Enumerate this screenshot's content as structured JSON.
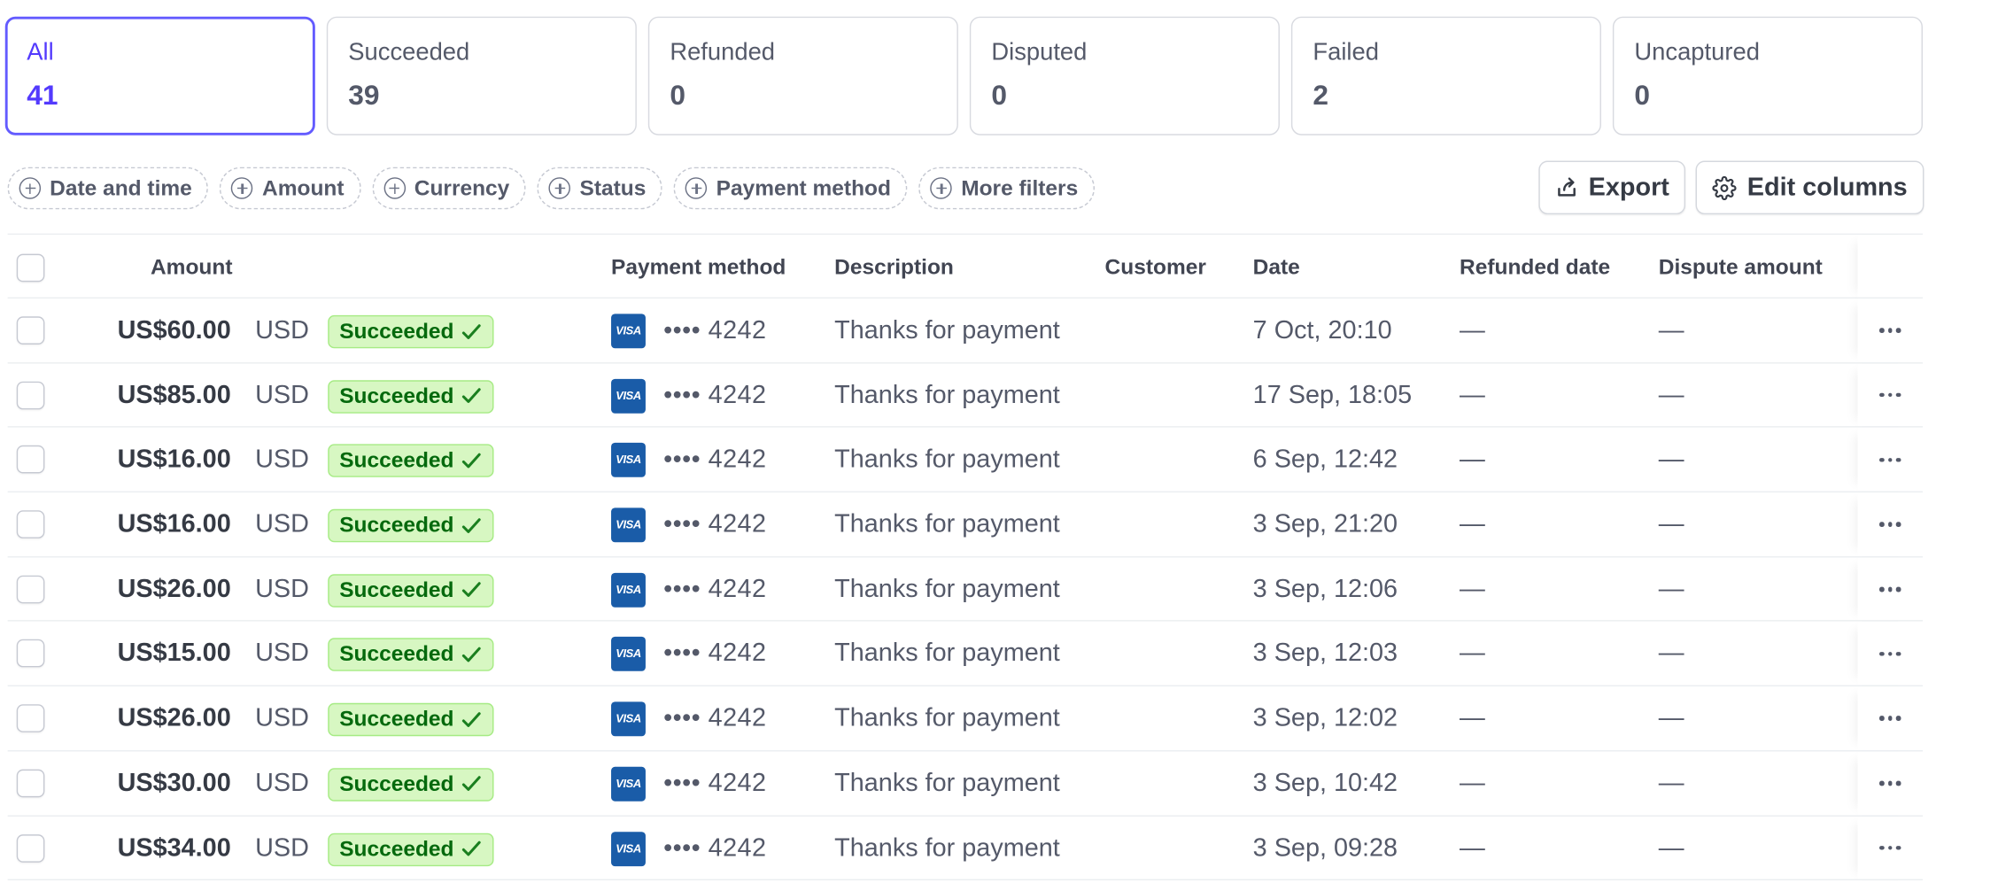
{
  "status_tabs": [
    {
      "label": "All",
      "count": "41",
      "active": true
    },
    {
      "label": "Succeeded",
      "count": "39",
      "active": false
    },
    {
      "label": "Refunded",
      "count": "0",
      "active": false
    },
    {
      "label": "Disputed",
      "count": "0",
      "active": false
    },
    {
      "label": "Failed",
      "count": "2",
      "active": false
    },
    {
      "label": "Uncaptured",
      "count": "0",
      "active": false
    }
  ],
  "filters": [
    "Date and time",
    "Amount",
    "Currency",
    "Status",
    "Payment method",
    "More filters"
  ],
  "actions": {
    "export_label": "Export",
    "edit_columns_label": "Edit columns"
  },
  "table": {
    "columns": {
      "amount": "Amount",
      "payment_method": "Payment method",
      "description": "Description",
      "customer": "Customer",
      "date": "Date",
      "refunded_date": "Refunded date",
      "dispute_amount": "Dispute amount"
    },
    "rows": [
      {
        "amount": "US$60.00",
        "currency": "USD",
        "status": "Succeeded",
        "card_brand": "VISA",
        "card_last4": "•••• 4242",
        "description": "Thanks for payment",
        "customer": "",
        "date": "7 Oct, 20:10",
        "refunded_date": "—",
        "dispute_amount": "—"
      },
      {
        "amount": "US$85.00",
        "currency": "USD",
        "status": "Succeeded",
        "card_brand": "VISA",
        "card_last4": "•••• 4242",
        "description": "Thanks for payment",
        "customer": "",
        "date": "17 Sep, 18:05",
        "refunded_date": "—",
        "dispute_amount": "—"
      },
      {
        "amount": "US$16.00",
        "currency": "USD",
        "status": "Succeeded",
        "card_brand": "VISA",
        "card_last4": "•••• 4242",
        "description": "Thanks for payment",
        "customer": "",
        "date": "6 Sep, 12:42",
        "refunded_date": "—",
        "dispute_amount": "—"
      },
      {
        "amount": "US$16.00",
        "currency": "USD",
        "status": "Succeeded",
        "card_brand": "VISA",
        "card_last4": "•••• 4242",
        "description": "Thanks for payment",
        "customer": "",
        "date": "3 Sep, 21:20",
        "refunded_date": "—",
        "dispute_amount": "—"
      },
      {
        "amount": "US$26.00",
        "currency": "USD",
        "status": "Succeeded",
        "card_brand": "VISA",
        "card_last4": "•••• 4242",
        "description": "Thanks for payment",
        "customer": "",
        "date": "3 Sep, 12:06",
        "refunded_date": "—",
        "dispute_amount": "—"
      },
      {
        "amount": "US$15.00",
        "currency": "USD",
        "status": "Succeeded",
        "card_brand": "VISA",
        "card_last4": "•••• 4242",
        "description": "Thanks for payment",
        "customer": "",
        "date": "3 Sep, 12:03",
        "refunded_date": "—",
        "dispute_amount": "—"
      },
      {
        "amount": "US$26.00",
        "currency": "USD",
        "status": "Succeeded",
        "card_brand": "VISA",
        "card_last4": "•••• 4242",
        "description": "Thanks for payment",
        "customer": "",
        "date": "3 Sep, 12:02",
        "refunded_date": "—",
        "dispute_amount": "—"
      },
      {
        "amount": "US$30.00",
        "currency": "USD",
        "status": "Succeeded",
        "card_brand": "VISA",
        "card_last4": "•••• 4242",
        "description": "Thanks for payment",
        "customer": "",
        "date": "3 Sep, 10:42",
        "refunded_date": "—",
        "dispute_amount": "—"
      },
      {
        "amount": "US$34.00",
        "currency": "USD",
        "status": "Succeeded",
        "card_brand": "VISA",
        "card_last4": "•••• 4242",
        "description": "Thanks for payment",
        "customer": "",
        "date": "3 Sep, 09:28",
        "refunded_date": "—",
        "dispute_amount": "—"
      }
    ]
  },
  "icons": {
    "filter_add": "plus-circle-icon",
    "export": "export-icon",
    "edit_columns": "gear-icon",
    "status_check": "checkmark-icon",
    "row_menu": "more-horizontal-icon",
    "card_brand": "visa-icon"
  },
  "colors": {
    "accent": "#635bff",
    "success_bg": "#d7f7c2",
    "success_text": "#05690d",
    "visa_blue": "#1a5ca8"
  }
}
